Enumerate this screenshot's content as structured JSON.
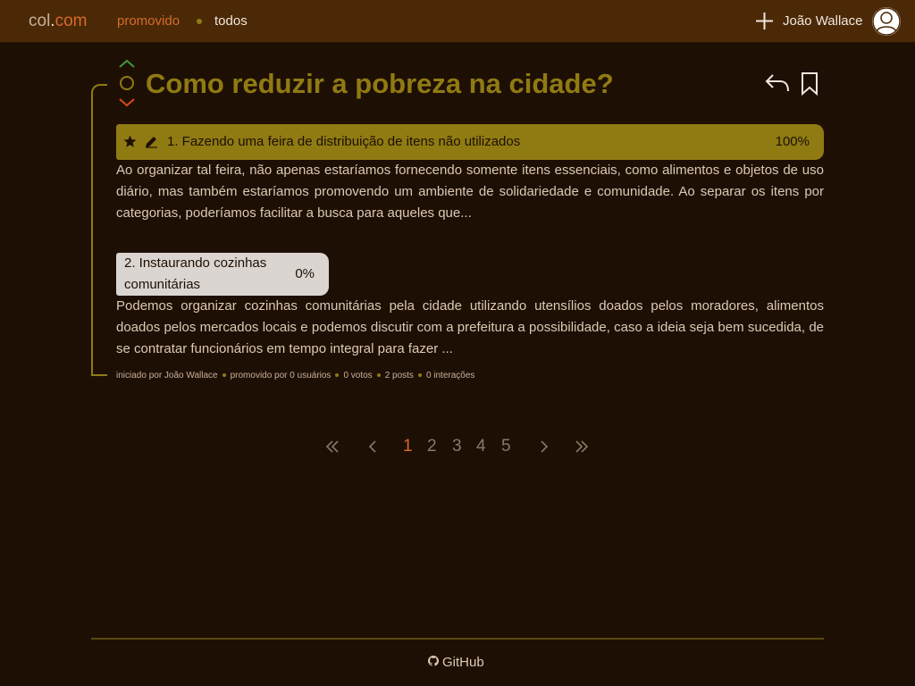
{
  "header": {
    "brand_main": "col",
    "brand_dot": ".",
    "brand_tld": "com",
    "nav_promovido": "promovido",
    "nav_todos": "todos",
    "user_name": "João Wallace"
  },
  "post": {
    "title": "Como reduzir a pobreza na cidade?",
    "options": [
      {
        "label": "1. Fazendo uma feira de distribuição de itens não utilizados",
        "percent": "100%",
        "description": "Ao organizar tal feira, não apenas estaríamos fornecendo somente itens essenciais, como alimentos e objetos de uso diário, mas também estaríamos promovendo um ambiente de solidariedade e comunidade. Ao separar os itens por categorias, poderíamos facilitar a busca para aqueles que..."
      },
      {
        "label": "2. Instaurando cozinhas comunitárias",
        "percent": "0%",
        "description": "Podemos organizar cozinhas comunitárias pela cidade utilizando utensílios doados pelos moradores, alimentos doados pelos mercados locais e podemos discutir com a prefeitura a possibilidade, caso a ideia seja bem sucedida, de se contratar funcionários em tempo integral para fazer ..."
      }
    ],
    "meta": {
      "started_by": "iniciado por João Wallace",
      "promoted_by": "promovido por 0 usuários",
      "votes": "0 votos",
      "posts": "2 posts",
      "interactions": "0 interações"
    }
  },
  "pagination": {
    "pages": [
      "1",
      "2",
      "3",
      "4",
      "5"
    ],
    "current": "1"
  },
  "footer": {
    "github_label": "GitHub"
  },
  "colors": {
    "background": "#1e0f05",
    "topbar": "#4b2907",
    "accent_olive": "#8f7b12",
    "accent_orange": "#d66a2a",
    "vote_up": "#3f9a3c",
    "vote_down": "#d64b1e"
  },
  "icons": {
    "add": "plus-icon",
    "avatar": "user-avatar-icon",
    "upvote": "chevron-up-icon",
    "downvote": "chevron-down-icon",
    "reply": "reply-arrow-icon",
    "bookmark": "bookmark-icon",
    "favorite": "star-icon",
    "edit": "pencil-icon",
    "first": "double-chevron-left-icon",
    "prev": "chevron-left-icon",
    "next": "chevron-right-icon",
    "last": "double-chevron-right-icon",
    "github": "github-icon"
  }
}
